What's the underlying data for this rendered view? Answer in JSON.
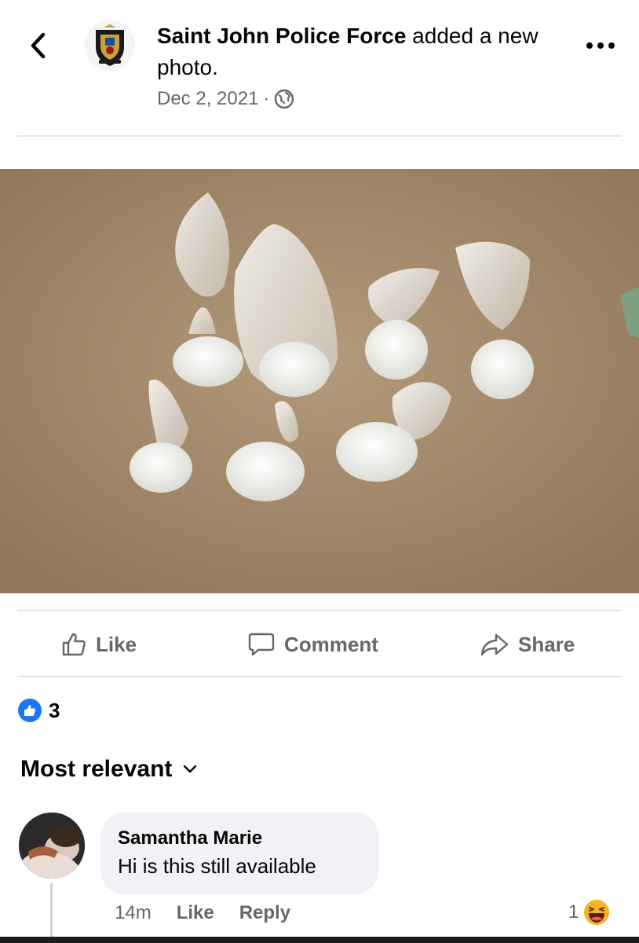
{
  "header": {
    "page_name": "Saint John Police Force",
    "action_text": " added a new photo.",
    "date": "Dec 2, 2021",
    "separator": "·",
    "back_icon": "chevron-left-icon",
    "privacy_icon": "globe-icon",
    "more_icon": "more-horizontal-icon"
  },
  "actions": {
    "like_label": "Like",
    "comment_label": "Comment",
    "share_label": "Share"
  },
  "reactions": {
    "count": "3",
    "icon": "like-reaction-icon",
    "color": "#1877f2"
  },
  "comments": {
    "sort_label": "Most relevant",
    "items": [
      {
        "author": "Samantha Marie",
        "text": "Hi is this still available",
        "time": "14m",
        "like_label": "Like",
        "reply_label": "Reply",
        "reaction_count": "1",
        "reaction_icon": "laughing-emoji-icon"
      }
    ]
  },
  "colors": {
    "accent": "#1877f2",
    "secondary_text": "#65676b",
    "bubble_bg": "#f0f2f5"
  }
}
